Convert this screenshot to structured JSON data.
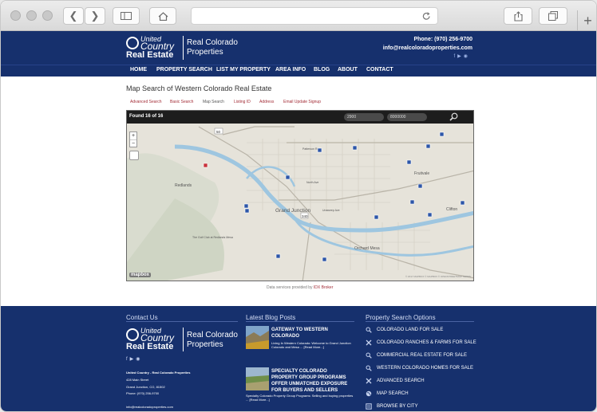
{
  "header": {
    "logo_united": "United",
    "logo_country": "Country",
    "logo_real_estate": "Real Estate",
    "logo_line1": "Real Colorado",
    "logo_line2": "Properties",
    "phone": "Phone: (970) 256-9700",
    "email": "info@realcoloradoproperties.com"
  },
  "nav": [
    "HOME",
    "PROPERTY SEARCH",
    "LIST MY PROPERTY",
    "AREA INFO",
    "BLOG",
    "ABOUT",
    "CONTACT"
  ],
  "page": {
    "title": "Map Search of Western Colorado Real Estate",
    "tabs": [
      "Advanced Search",
      "Basic Search",
      "Map Search",
      "Listing ID",
      "Address",
      "Email Update Signup"
    ],
    "active_tab": "Map Search"
  },
  "map": {
    "found": "Found 16 of 16",
    "min_price": "2900",
    "max_price": "8000000",
    "zoom_in": "+",
    "zoom_out": "−",
    "logo": "mapbox",
    "attribution": "© 2017 MAPBOX © MAPBOX © OPENSTREETMAP TERMS",
    "labels": [
      "Grand Junction",
      "Redlands",
      "Orchard Mesa",
      "Fruitvale",
      "Clifton",
      "The Golf Club at Redlands Mesa",
      "North Ave",
      "Patterson Rd",
      "Unaweep Ave"
    ],
    "route_labels": [
      "50",
      "340",
      "6"
    ],
    "marker_count": 16
  },
  "data_services": {
    "prefix": "Data services provided by ",
    "link": "IDX Broker"
  },
  "footer": {
    "contact_heading": "Contact Us",
    "company": "United Country - Real Colorado Properties",
    "street": "428 Main Street",
    "city": "Grand Junction, CO, 81502",
    "phone": "Phone: (970) 256-9700",
    "email": "info@realcoloradoproperties.com",
    "blog_heading": "Latest Blog Posts",
    "posts": [
      {
        "title": "GATEWAY TO WESTERN COLORADO",
        "excerpt": " Living In Western Colorado: Welcome to Grand Junction Colorado and Mesa ... [Read More...]"
      },
      {
        "title": "SPECIALTY COLORADO PROPERTY GROUP PROGRAMS OFFER UNMATCHED EXPOSURE FOR BUYERS AND SELLERS",
        "excerpt": "Specialty Colorado Property Group Programs: Selling and buying properties ... [Read More...]"
      }
    ],
    "options_heading": "Property Search Options",
    "options": [
      {
        "label": "COLORADO LAND FOR SALE",
        "icon": "search-icon"
      },
      {
        "label": "COLORADO RANCHES & FARMS FOR SALE",
        "icon": "tools-icon"
      },
      {
        "label": "COMMERCIAL REAL ESTATE FOR SALE",
        "icon": "search-icon"
      },
      {
        "label": "WESTERN COLORADO HOMES FOR SALE",
        "icon": "search-icon"
      },
      {
        "label": "ADVANCED SEARCH",
        "icon": "tools-icon"
      },
      {
        "label": "MAP SEARCH",
        "icon": "globe-icon"
      },
      {
        "label": "BROWSE BY CITY",
        "icon": "list-icon"
      }
    ]
  },
  "colors": {
    "brand_navy": "#16306d",
    "link_red": "#a32d37",
    "map_bar": "#1d1d1d",
    "river_blue": "#9ec6e0"
  }
}
